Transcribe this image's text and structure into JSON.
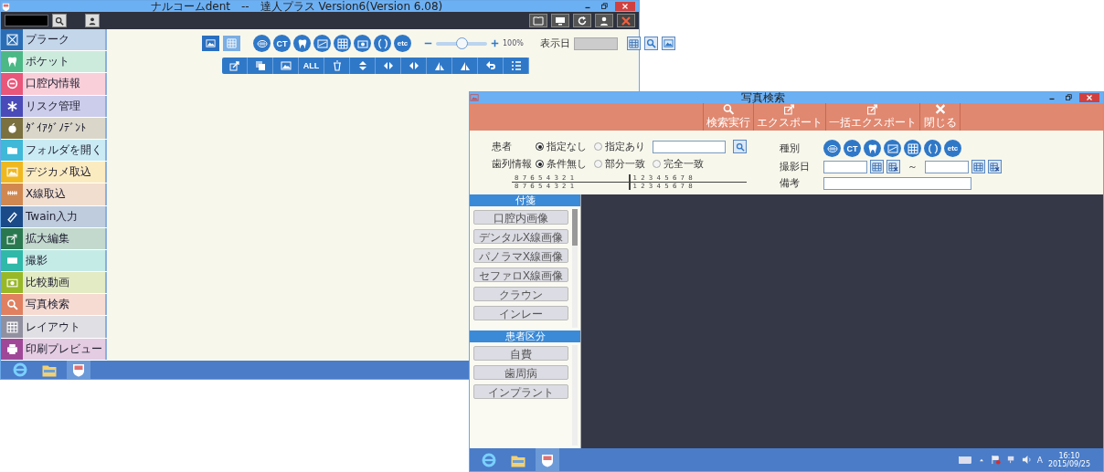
{
  "main_window": {
    "title": "ナルコームdent　--　達人プラス Version6(Version 6.08)"
  },
  "sidebar": {
    "items": [
      {
        "label": "プラーク",
        "color": "#2a6db5"
      },
      {
        "label": "ポケット",
        "color": "#4cb886"
      },
      {
        "label": "口腔内情報",
        "color": "#e8567a"
      },
      {
        "label": "リスク管理",
        "color": "#4a4ab8"
      },
      {
        "label": "ﾀﾞｲｱｸﾞﾉﾃﾞﾝﾄ",
        "color": "#7a7040"
      },
      {
        "label": "フォルダを開く",
        "color": "#40b8d8"
      },
      {
        "label": "デジカメ取込",
        "color": "#f0b820"
      },
      {
        "label": "X線取込",
        "color": "#d08850"
      },
      {
        "label": "Twain入力",
        "color": "#1a4a88"
      },
      {
        "label": "拡大編集",
        "color": "#2a7850"
      },
      {
        "label": "撮影",
        "color": "#30b8a8"
      },
      {
        "label": "比較動画",
        "color": "#98b828"
      },
      {
        "label": "写真検索",
        "color": "#e08060"
      },
      {
        "label": "レイアウト",
        "color": "#9090a0"
      },
      {
        "label": "印刷プレビュー",
        "color": "#a04898"
      }
    ]
  },
  "toolbar": {
    "view_toggles": [
      {
        "selected": true
      },
      {
        "selected": false
      }
    ],
    "type_filters": [
      {
        "kind": "icon"
      },
      {
        "kind": "text",
        "label": "CT"
      },
      {
        "kind": "icon"
      },
      {
        "kind": "icon"
      },
      {
        "kind": "icon"
      },
      {
        "kind": "icon"
      },
      {
        "kind": "icon"
      },
      {
        "kind": "text",
        "label": "etc"
      }
    ],
    "zoom": {
      "level": 0.5,
      "reading": "100%"
    },
    "date_label": "表示日",
    "actions": [
      {
        "kind": "icon"
      },
      {
        "kind": "icon"
      },
      {
        "kind": "icon"
      },
      {
        "kind": "text",
        "label": "ALL"
      },
      {
        "kind": "icon"
      },
      {
        "kind": "icon"
      },
      {
        "kind": "icon"
      },
      {
        "kind": "icon"
      },
      {
        "kind": "icon"
      },
      {
        "kind": "icon"
      },
      {
        "kind": "icon"
      },
      {
        "kind": "icon"
      }
    ]
  },
  "dialog": {
    "title": "写真検索",
    "actions": [
      {
        "label": "検索実行"
      },
      {
        "label": "エクスポート"
      },
      {
        "label": "一括エクスポート"
      },
      {
        "label": "閉じる"
      }
    ],
    "patient": {
      "label": "患者",
      "options": [
        {
          "label": "指定なし",
          "selected": true
        },
        {
          "label": "指定あり",
          "selected": false
        }
      ]
    },
    "dentition": {
      "label": "歯列情報",
      "options": [
        {
          "label": "条件無し",
          "selected": true
        },
        {
          "label": "部分一致",
          "selected": false
        },
        {
          "label": "完全一致",
          "selected": false
        }
      ]
    },
    "tooth_chart": {
      "rows": [
        {
          "right": "8 7 6 5 4 3 2 1",
          "left": "1 2 3 4 5 6 7 8"
        },
        {
          "right": "8 7 6 5 4 3 2 1",
          "left": "1 2 3 4 5 6 7 8"
        }
      ]
    },
    "type": {
      "label": "種別",
      "filters": [
        {
          "kind": "icon"
        },
        {
          "kind": "text",
          "label": "CT"
        },
        {
          "kind": "icon"
        },
        {
          "kind": "icon"
        },
        {
          "kind": "icon"
        },
        {
          "kind": "icon"
        },
        {
          "kind": "text",
          "label": "etc"
        }
      ]
    },
    "date": {
      "label": "撮影日",
      "separator": "～"
    },
    "note": {
      "label": "備考"
    },
    "tag_panel": {
      "title": "付箋",
      "items": [
        "口腔内画像",
        "デンタルX線画像",
        "パノラマX線画像",
        "セファロX線画像",
        "クラウン",
        "インレー"
      ]
    },
    "patient_category": {
      "title": "患者区分",
      "items": [
        "自費",
        "歯周病",
        "インプラント"
      ]
    }
  },
  "taskbar": {
    "clock": {
      "time": "16:10",
      "date": "2015/09/25"
    },
    "ime": "A"
  }
}
